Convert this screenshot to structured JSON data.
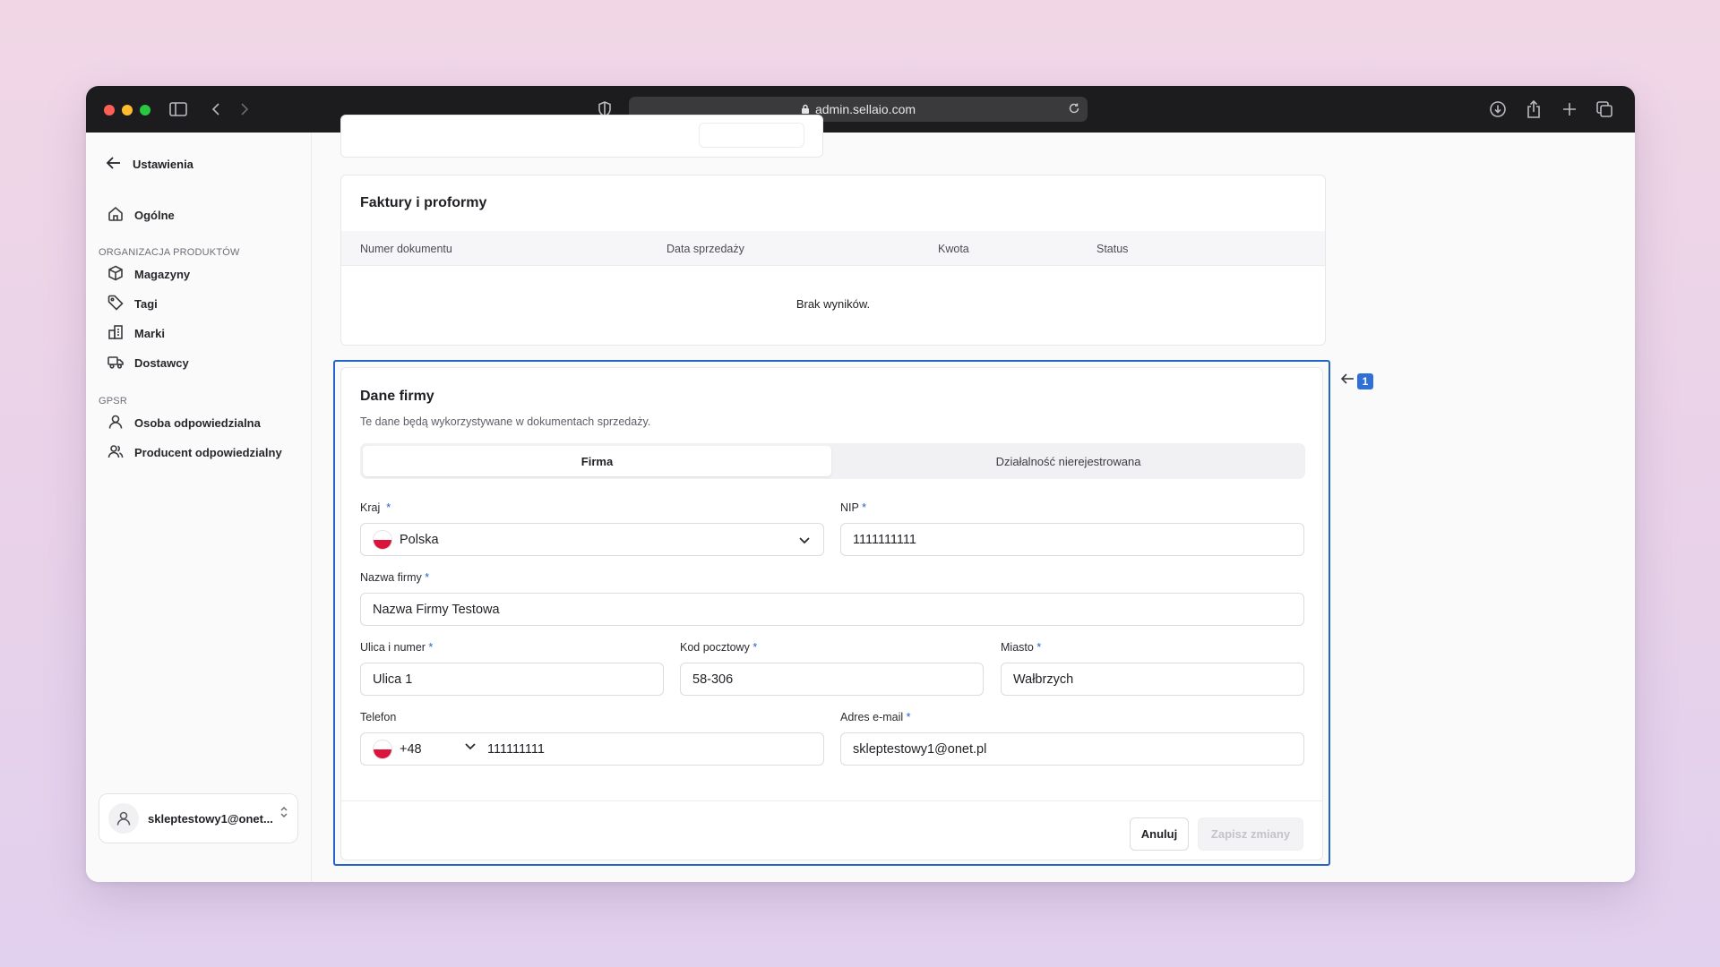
{
  "browser": {
    "url": "admin.sellaio.com"
  },
  "sidebar": {
    "back_label": "Ustawienia",
    "general_label": "Ogólne",
    "section_products": "ORGANIZACJA PRODUKTÓW",
    "products_items": [
      {
        "label": "Magazyny",
        "icon": "box-icon"
      },
      {
        "label": "Tagi",
        "icon": "tag-icon"
      },
      {
        "label": "Marki",
        "icon": "brand-icon"
      },
      {
        "label": "Dostawcy",
        "icon": "truck-icon"
      }
    ],
    "section_gpsr": "GPSR",
    "gpsr_items": [
      {
        "label": "Osoba odpowiedzialna",
        "icon": "user-icon"
      },
      {
        "label": "Producent odpowiedzialny",
        "icon": "users-icon"
      }
    ],
    "account_email": "skleptestowy1@onet..."
  },
  "invoices": {
    "title": "Faktury i proformy",
    "columns": [
      "Numer dokumentu",
      "Data sprzedaży",
      "Kwota",
      "Status"
    ],
    "empty_text": "Brak wyników."
  },
  "company": {
    "title": "Dane firmy",
    "subtitle": "Te dane będą wykorzystywane w dokumentach sprzedaży.",
    "tabs": [
      {
        "label": "Firma",
        "active": true
      },
      {
        "label": "Działalność nierejestrowana",
        "active": false
      }
    ],
    "fields": {
      "country": {
        "label": "Kraj",
        "value": "Polska"
      },
      "nip": {
        "label": "NIP",
        "value": "1111111111"
      },
      "company_name": {
        "label": "Nazwa firmy",
        "value": "Nazwa Firmy Testowa"
      },
      "street": {
        "label": "Ulica i numer",
        "value": "Ulica 1"
      },
      "postal_code": {
        "label": "Kod pocztowy",
        "value": "58-306"
      },
      "city": {
        "label": "Miasto",
        "value": "Wałbrzych"
      },
      "phone": {
        "label": "Telefon",
        "prefix": "+48",
        "value": "111111111"
      },
      "email": {
        "label": "Adres e-mail",
        "value": "skleptestowy1@onet.pl"
      }
    },
    "required_mark": "*",
    "cancel_label": "Anuluj",
    "save_label": "Zapisz zmiany"
  },
  "annotation": {
    "badge": "1"
  },
  "colors": {
    "accent": "#2563c9",
    "chat": "#1d5ad6"
  }
}
